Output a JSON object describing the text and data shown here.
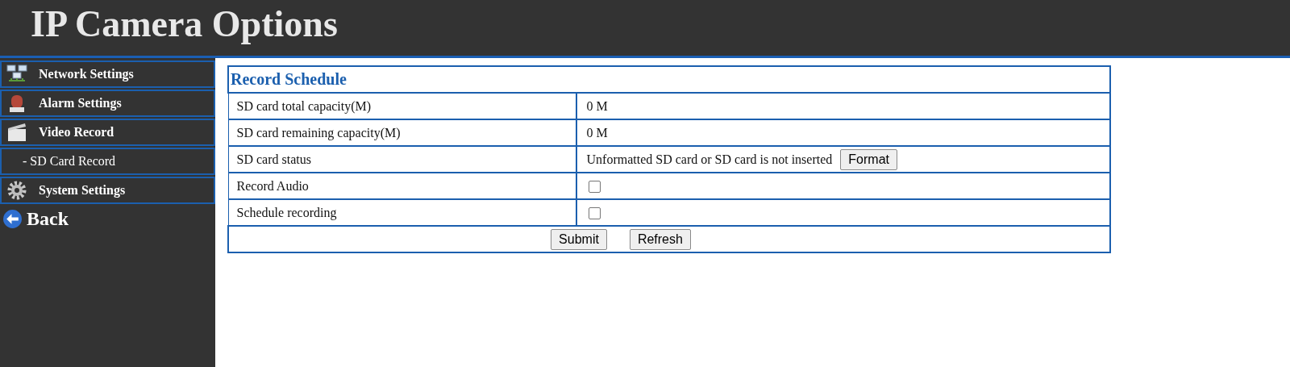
{
  "header": {
    "title": "IP Camera Options"
  },
  "sidebar": {
    "items": [
      {
        "label": "Network Settings",
        "kind": "network"
      },
      {
        "label": "Alarm Settings",
        "kind": "alarm"
      },
      {
        "label": "Video Record",
        "kind": "video"
      },
      {
        "label": "- SD Card Record",
        "kind": "sub"
      },
      {
        "label": "System Settings",
        "kind": "gear"
      }
    ],
    "back": {
      "label": "Back"
    }
  },
  "panel": {
    "title": "Record Schedule",
    "rows": [
      {
        "kind": "text",
        "label": "SD card total capacity(M)",
        "value": "0 M"
      },
      {
        "kind": "text",
        "label": "SD card remaining capacity(M)",
        "value": "0 M"
      },
      {
        "kind": "status",
        "label": "SD card status",
        "value": "Unformatted SD card or SD card is not inserted",
        "button": "Format"
      },
      {
        "kind": "checkbox",
        "label": "Record Audio",
        "checked": false
      },
      {
        "kind": "checkbox",
        "label": "Schedule recording",
        "checked": false
      }
    ],
    "buttons": [
      "Submit",
      "Refresh"
    ]
  }
}
